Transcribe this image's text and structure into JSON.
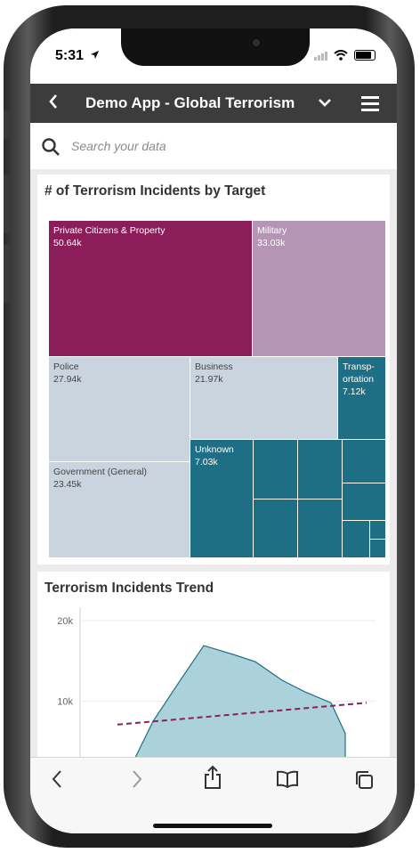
{
  "status_bar": {
    "time": "5:31"
  },
  "nav": {
    "title": "Demo App - Global Terrorism"
  },
  "search": {
    "placeholder": "Search your data"
  },
  "treemap_card": {
    "title": "# of Terrorism Incidents by Target",
    "colors": {
      "magenta": "#8c1d5b",
      "mauve": "#b496b4",
      "light_blue": "#c9d4df",
      "teal": "#1e6e85"
    }
  },
  "trend_card": {
    "title": "Terrorism Incidents Trend"
  },
  "chart_data": [
    {
      "type": "treemap",
      "title": "# of Terrorism Incidents by Target",
      "items": [
        {
          "name": "Private Citizens & Property",
          "label": "Private Citizens & Property",
          "value_label": "50.64k",
          "value": 50640
        },
        {
          "name": "Military",
          "label": "Military",
          "value_label": "33.03k",
          "value": 33030
        },
        {
          "name": "Police",
          "label": "Police",
          "value_label": "27.94k",
          "value": 27940
        },
        {
          "name": "Government (General)",
          "label": "Government (General)",
          "value_label": "23.45k",
          "value": 23450
        },
        {
          "name": "Business",
          "label": "Business",
          "value_label": "21.97k",
          "value": 21970
        },
        {
          "name": "Transportation",
          "label": "Transp-ortation",
          "value_label": "7.12k",
          "value": 7120
        },
        {
          "name": "Unknown",
          "label": "Unknown",
          "value_label": "7.03k",
          "value": 7030
        }
      ]
    },
    {
      "type": "area",
      "title": "Terrorism Incidents Trend",
      "ytick_labels": [
        "20k",
        "10k"
      ],
      "ylim": [
        0,
        21000
      ],
      "series": [
        {
          "values": [
            3000,
            7500,
            12500,
            16900,
            15800,
            14900,
            12600,
            11200,
            9800,
            6000
          ]
        }
      ],
      "trendline": {
        "style": "dashed",
        "from": 7100,
        "to": 9800,
        "color": "#8c1d5b"
      }
    }
  ]
}
